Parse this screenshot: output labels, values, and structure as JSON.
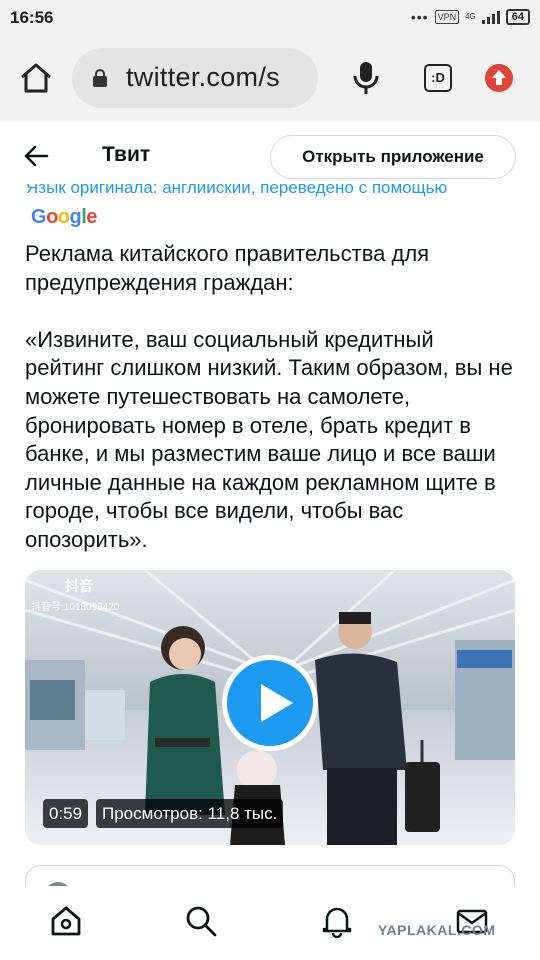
{
  "status_bar": {
    "time": "16:56",
    "vpn": "VPN",
    "network": "4G",
    "battery": "64"
  },
  "browser": {
    "url": "twitter.com/s",
    "tabs_label": ":D"
  },
  "header": {
    "title": "Твит",
    "open_app_label": "Открыть приложение"
  },
  "tweet": {
    "translated_note": "Язык оригинала: английский, переведено с помощью",
    "google_label": "Google",
    "intro": "Реклама китайского правительства для предупреждения граждан:",
    "quote": "«Извините, ваш социальный кредитный рейтинг слишком низкий. Таким образом, вы не можете путешествовать на самолете, бронировать номер в отеле, брать кредит в банке, и мы разместим ваше лицо и все ваши личные данные на каждом рекламном щите в городе, чтобы все видели, чтобы вас опозорить»."
  },
  "video": {
    "watermark": "抖音",
    "watermark_id": "抖音号:1018098420",
    "duration": "0:59",
    "views": "Просмотров: 11,8 тыс."
  },
  "watermark_site": "YAPLAKAL.COM",
  "colors": {
    "accent": "#1d9bf0",
    "text": "#0f1419",
    "border": "#cfd9de"
  }
}
